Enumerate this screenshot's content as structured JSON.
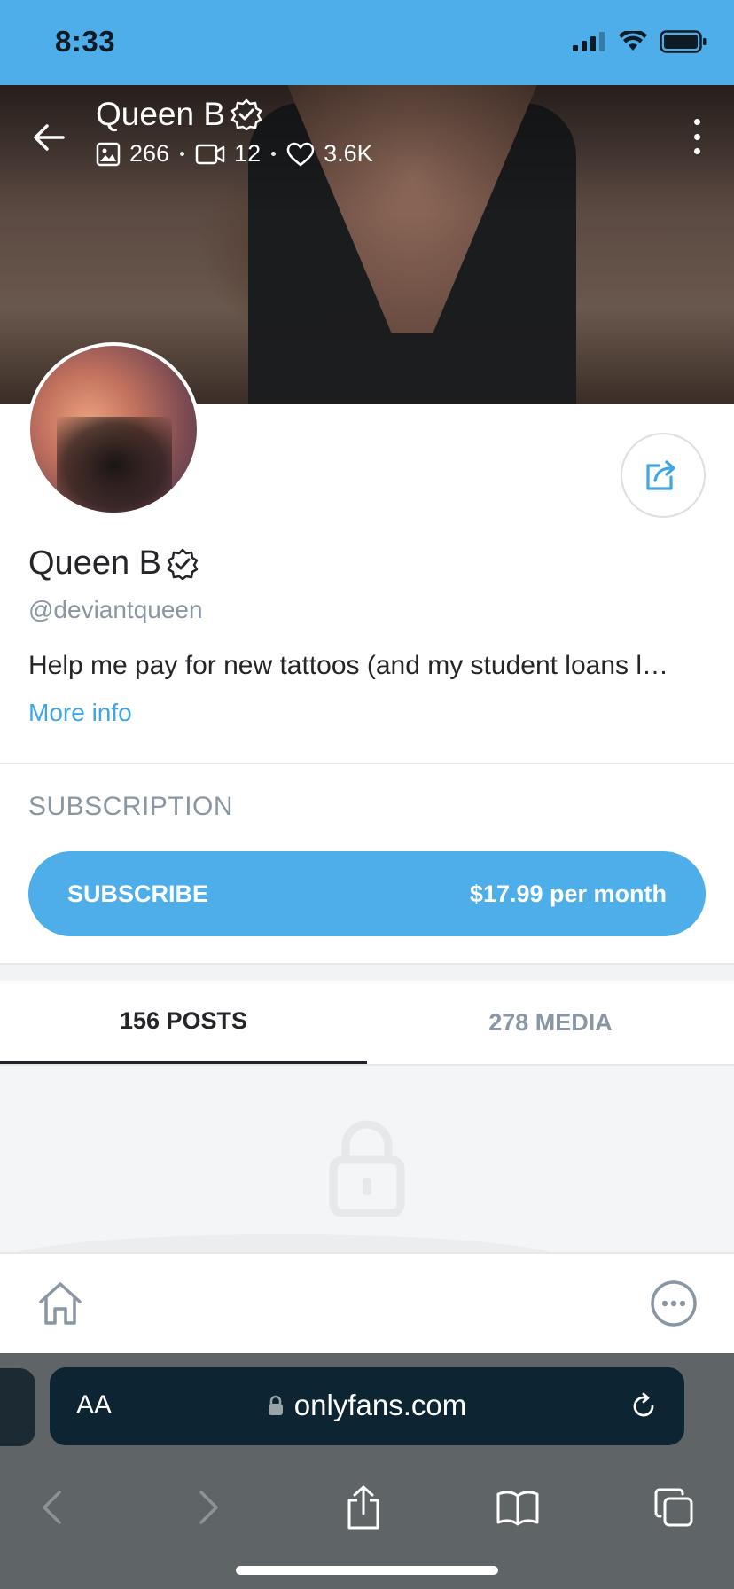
{
  "status_bar": {
    "time": "8:33"
  },
  "header": {
    "name": "Queen B",
    "stats": {
      "photos": "266",
      "videos": "12",
      "likes": "3.6K"
    }
  },
  "profile": {
    "name": "Queen B",
    "handle": "@deviantqueen",
    "bio": "Help me pay for new tattoos (and my student loans l…",
    "more_info": "More info"
  },
  "subscription": {
    "heading": "SUBSCRIPTION",
    "button_label": "SUBSCRIBE",
    "price": "$17.99 per month"
  },
  "tabs": [
    {
      "label": "156 POSTS",
      "active": true
    },
    {
      "label": "278 MEDIA",
      "active": false
    }
  ],
  "browser": {
    "text_size_label": "AA",
    "domain": "onlyfans.com"
  },
  "colors": {
    "accent": "#4eaeea",
    "link": "#3ea6e4",
    "muted": "#8a96a3",
    "text": "#242529"
  }
}
